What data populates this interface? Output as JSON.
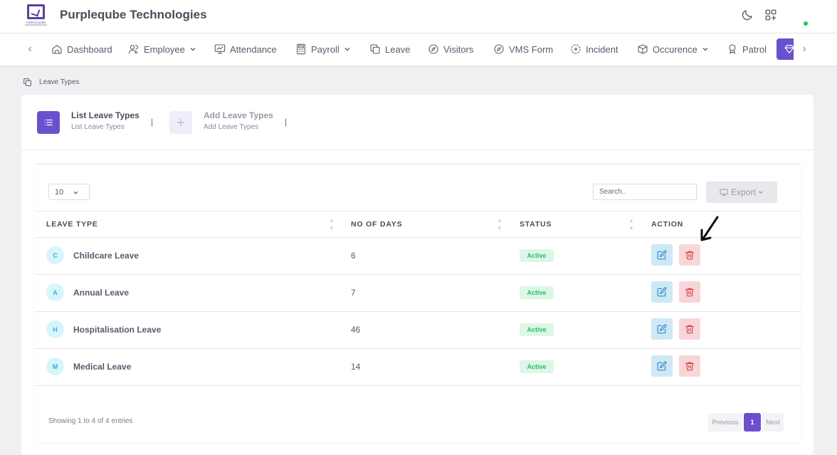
{
  "app": {
    "title": "Purpleqube Technologies",
    "logo_text": "PURPLEQUBE"
  },
  "header_icons": [
    "moon-icon",
    "apps-grid-icon"
  ],
  "nav": {
    "items": [
      {
        "label": "Dashboard",
        "icon": "home-icon",
        "has_dropdown": false
      },
      {
        "label": "Employee",
        "icon": "users-icon",
        "has_dropdown": true
      },
      {
        "label": "Attendance",
        "icon": "monitor-chart-icon",
        "has_dropdown": false
      },
      {
        "label": "Payroll",
        "icon": "calculator-icon",
        "has_dropdown": true
      },
      {
        "label": "Leave",
        "icon": "copy-icon",
        "has_dropdown": false
      },
      {
        "label": "Visitors",
        "icon": "compass-icon",
        "has_dropdown": false
      },
      {
        "label": "VMS Form",
        "icon": "compass-icon",
        "has_dropdown": false
      },
      {
        "label": "Incident",
        "icon": "focus-icon",
        "has_dropdown": false
      },
      {
        "label": "Occurence",
        "icon": "box-icon",
        "has_dropdown": true
      },
      {
        "label": "Patrol",
        "icon": "badge-icon",
        "has_dropdown": false
      }
    ],
    "active_item_icon": "diamond-icon"
  },
  "breadcrumb": {
    "label": "Leave Types"
  },
  "tabs": [
    {
      "title": "List Leave Types",
      "subtitle": "List Leave Types",
      "active": true
    },
    {
      "title": "Add Leave Types",
      "subtitle": "Add Leave Types",
      "active": false
    }
  ],
  "table_controls": {
    "page_length": "10",
    "search_placeholder": "Search..",
    "export_label": "Export"
  },
  "table": {
    "columns": [
      "LEAVE TYPE",
      "NO OF DAYS",
      "STATUS",
      "ACTION"
    ],
    "rows": [
      {
        "initial": "C",
        "name": "Childcare Leave",
        "days": "6",
        "status": "Active"
      },
      {
        "initial": "A",
        "name": "Annual Leave",
        "days": "7",
        "status": "Active"
      },
      {
        "initial": "H",
        "name": "Hospitalisation Leave",
        "days": "46",
        "status": "Active"
      },
      {
        "initial": "M",
        "name": "Medical Leave",
        "days": "14",
        "status": "Active"
      }
    ]
  },
  "footer": {
    "info": "Showing 1 to 4 of 4 entries",
    "prev": "Previous",
    "current": "1",
    "next": "Next"
  },
  "colors": {
    "accent": "#6a4fcf",
    "status_active_bg": "#dcf7e5",
    "status_active_text": "#2ebd6b",
    "edit_bg": "#cfe8f5",
    "delete_bg": "#f8d6d8",
    "online": "#22c55e"
  }
}
